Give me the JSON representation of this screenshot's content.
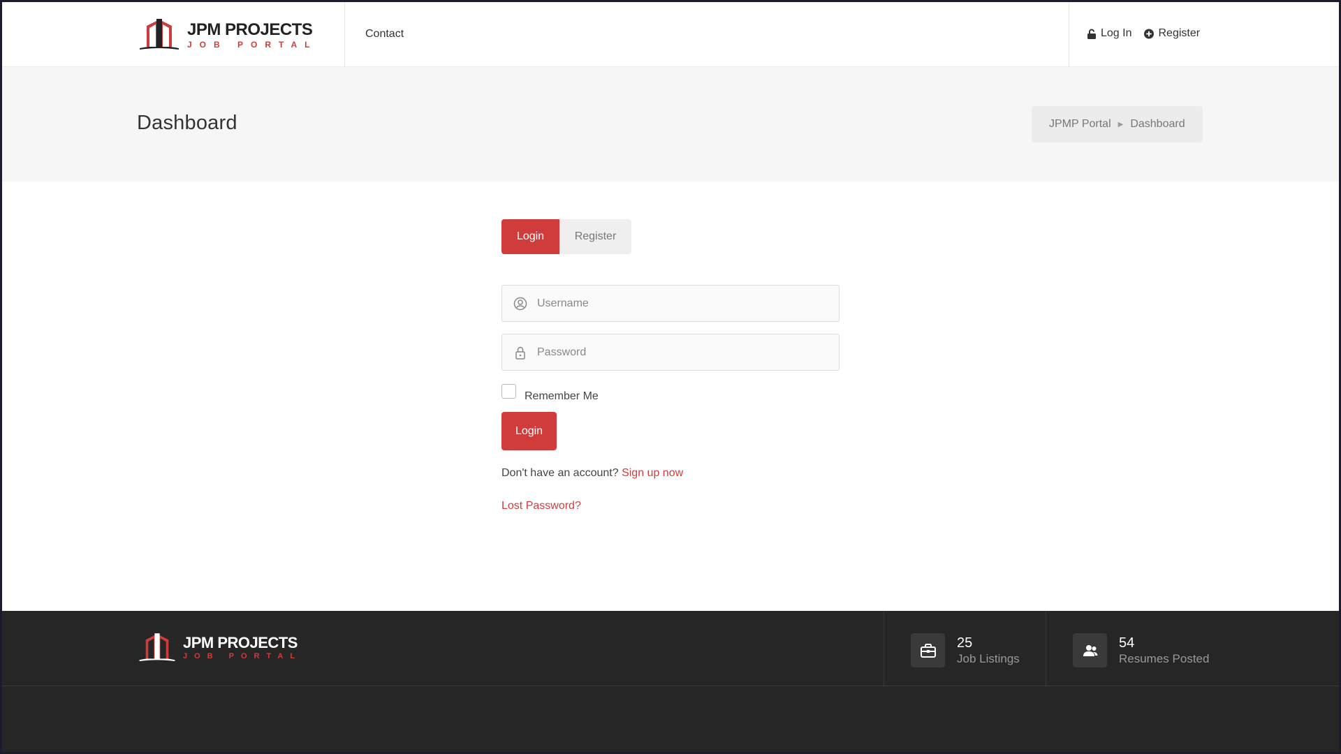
{
  "brand": {
    "title": "JPM PROJECTS",
    "subtitle": "JOB PORTAL",
    "accent": "#d03c3c"
  },
  "nav": {
    "contact": "Contact",
    "login": "Log In",
    "register": "Register"
  },
  "page": {
    "title": "Dashboard"
  },
  "breadcrumb": {
    "items": [
      "JPMP Portal",
      "Dashboard"
    ]
  },
  "auth_tabs": {
    "login": "Login",
    "register": "Register",
    "active": "Login"
  },
  "form": {
    "username_placeholder": "Username",
    "password_placeholder": "Password",
    "remember_label": "Remember Me",
    "remember_checked": false,
    "submit_label": "Login",
    "signup_prompt": "Don't have an account?",
    "signup_link": "Sign up now",
    "lost_password": "Lost Password?"
  },
  "footer": {
    "brand_title": "JPM PROJECTS",
    "brand_subtitle": "JOB PORTAL",
    "stats": [
      {
        "value": "25",
        "label": "Job Listings",
        "icon": "briefcase-icon"
      },
      {
        "value": "54",
        "label": "Resumes Posted",
        "icon": "users-icon"
      }
    ]
  }
}
